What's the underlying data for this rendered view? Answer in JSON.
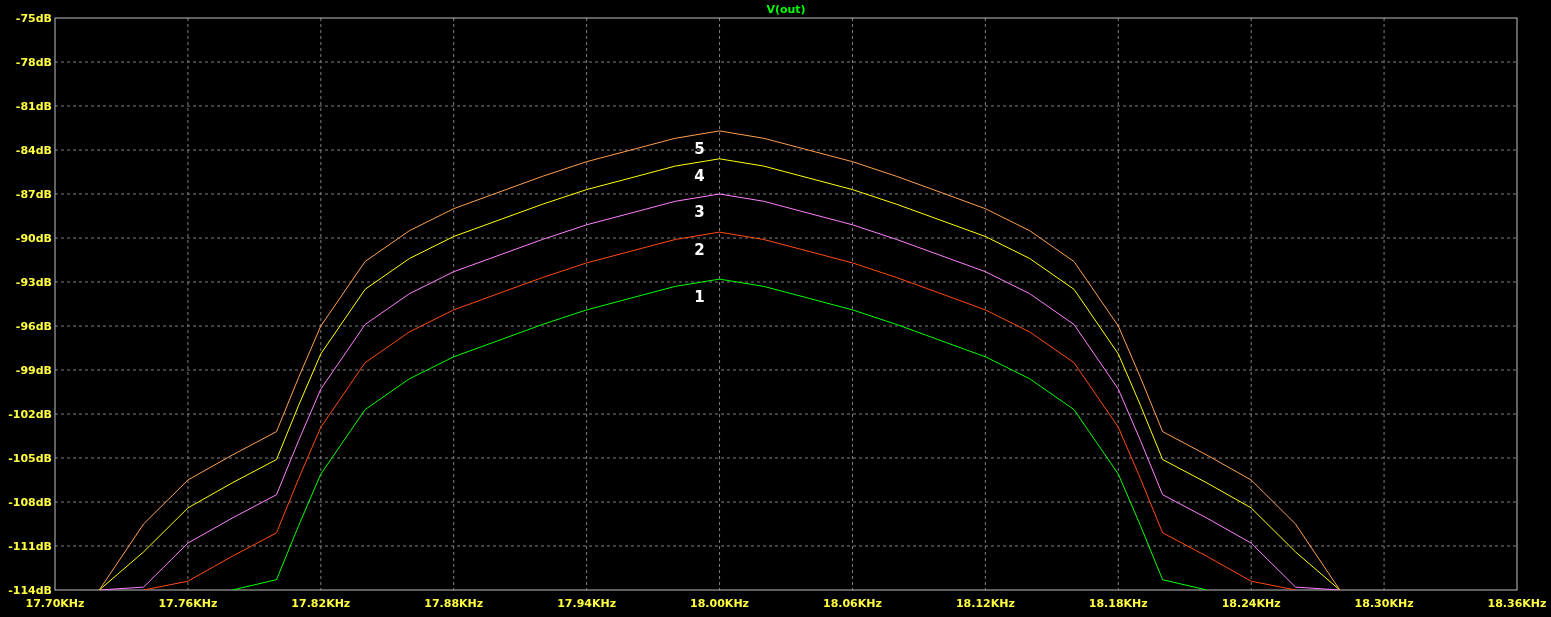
{
  "plot": {
    "chart_data": {
      "type": "line",
      "title": "V(out)",
      "x": [
        17.72,
        17.74,
        17.76,
        17.78,
        17.8,
        17.81,
        17.82,
        17.84,
        17.86,
        17.88,
        17.9,
        17.92,
        17.94,
        17.96,
        17.98,
        18.0,
        18.02,
        18.04,
        18.06,
        18.08,
        18.1,
        18.12,
        18.14,
        18.16,
        18.18,
        18.19,
        18.2,
        18.22,
        18.24,
        18.26,
        18.28
      ],
      "series": [
        {
          "name": "1",
          "color": "#00ff00",
          "values": [
            null,
            null,
            null,
            -114,
            -113.3,
            -109.6,
            -106.1,
            -101.7,
            -99.6,
            -98.1,
            -97.0,
            -95.9,
            -94.9,
            -94.1,
            -93.3,
            -92.8,
            -93.3,
            -94.1,
            -94.9,
            -95.9,
            -97.0,
            -98.1,
            -99.6,
            -101.7,
            -106.1,
            -109.6,
            -113.3,
            -114,
            null,
            null,
            null
          ]
        },
        {
          "name": "2",
          "color": "#ff4a10",
          "values": [
            null,
            -114,
            -113.4,
            -111.7,
            -110.1,
            -106.4,
            -102.9,
            -98.5,
            -96.4,
            -94.9,
            -93.8,
            -92.7,
            -91.7,
            -90.9,
            -90.1,
            -89.6,
            -90.1,
            -90.9,
            -91.7,
            -92.7,
            -93.8,
            -94.9,
            -96.4,
            -98.5,
            -102.9,
            -106.4,
            -110.1,
            -111.7,
            -113.4,
            -114,
            null
          ]
        },
        {
          "name": "3",
          "color": "#ff80ff",
          "values": [
            -114,
            -113.8,
            -110.8,
            -109.1,
            -107.5,
            -103.8,
            -100.3,
            -95.9,
            -93.8,
            -92.3,
            -91.2,
            -90.1,
            -89.1,
            -88.3,
            -87.5,
            -87.0,
            -87.5,
            -88.3,
            -89.1,
            -90.1,
            -91.2,
            -92.3,
            -93.8,
            -95.9,
            -100.3,
            -103.8,
            -107.5,
            -109.1,
            -110.8,
            -113.8,
            -114
          ]
        },
        {
          "name": "4",
          "color": "#ffff00",
          "values": [
            -114,
            -111.4,
            -108.4,
            -106.7,
            -105.1,
            -101.4,
            -97.9,
            -93.5,
            -91.4,
            -89.9,
            -88.8,
            -87.7,
            -86.7,
            -85.9,
            -85.1,
            -84.6,
            -85.1,
            -85.9,
            -86.7,
            -87.7,
            -88.8,
            -89.9,
            -91.4,
            -93.5,
            -97.9,
            -101.4,
            -105.1,
            -106.7,
            -108.4,
            -111.4,
            -114
          ]
        },
        {
          "name": "5",
          "color": "#ffa050",
          "values": [
            -114,
            -109.5,
            -106.5,
            -104.8,
            -103.2,
            -99.5,
            -96.0,
            -91.6,
            -89.5,
            -88.0,
            -86.9,
            -85.8,
            -84.8,
            -84.0,
            -83.2,
            -82.7,
            -83.2,
            -84.0,
            -84.8,
            -85.8,
            -86.9,
            -88.0,
            -89.5,
            -91.6,
            -96.0,
            -99.5,
            -103.2,
            -104.8,
            -106.5,
            -109.5,
            -114
          ]
        }
      ],
      "grid": true,
      "xlim": [
        17.7,
        18.36
      ],
      "ylim": [
        -114,
        -75
      ],
      "xticks": [
        {
          "value": 17.7,
          "label": "17.70KHz"
        },
        {
          "value": 17.76,
          "label": "17.76KHz"
        },
        {
          "value": 17.82,
          "label": "17.82KHz"
        },
        {
          "value": 17.88,
          "label": "17.88KHz"
        },
        {
          "value": 17.94,
          "label": "17.94KHz"
        },
        {
          "value": 18.0,
          "label": "18.00KHz"
        },
        {
          "value": 18.06,
          "label": "18.06KHz"
        },
        {
          "value": 18.12,
          "label": "18.12KHz"
        },
        {
          "value": 18.18,
          "label": "18.18KHz"
        },
        {
          "value": 18.24,
          "label": "18.24KHz"
        },
        {
          "value": 18.3,
          "label": "18.30KHz"
        },
        {
          "value": 18.36,
          "label": "18.36KHz"
        }
      ],
      "yticks": [
        {
          "value": -75,
          "label": "-75dB"
        },
        {
          "value": -78,
          "label": "-78dB"
        },
        {
          "value": -81,
          "label": "-81dB"
        },
        {
          "value": -84,
          "label": "-84dB"
        },
        {
          "value": -87,
          "label": "-87dB"
        },
        {
          "value": -90,
          "label": "-90dB"
        },
        {
          "value": -93,
          "label": "-93dB"
        },
        {
          "value": -96,
          "label": "-96dB"
        },
        {
          "value": -99,
          "label": "-99dB"
        },
        {
          "value": -102,
          "label": "-102dB"
        },
        {
          "value": -105,
          "label": "-105dB"
        },
        {
          "value": -108,
          "label": "-108dB"
        },
        {
          "value": -111,
          "label": "-111dB"
        },
        {
          "value": -114,
          "label": "-114dB"
        }
      ]
    }
  }
}
